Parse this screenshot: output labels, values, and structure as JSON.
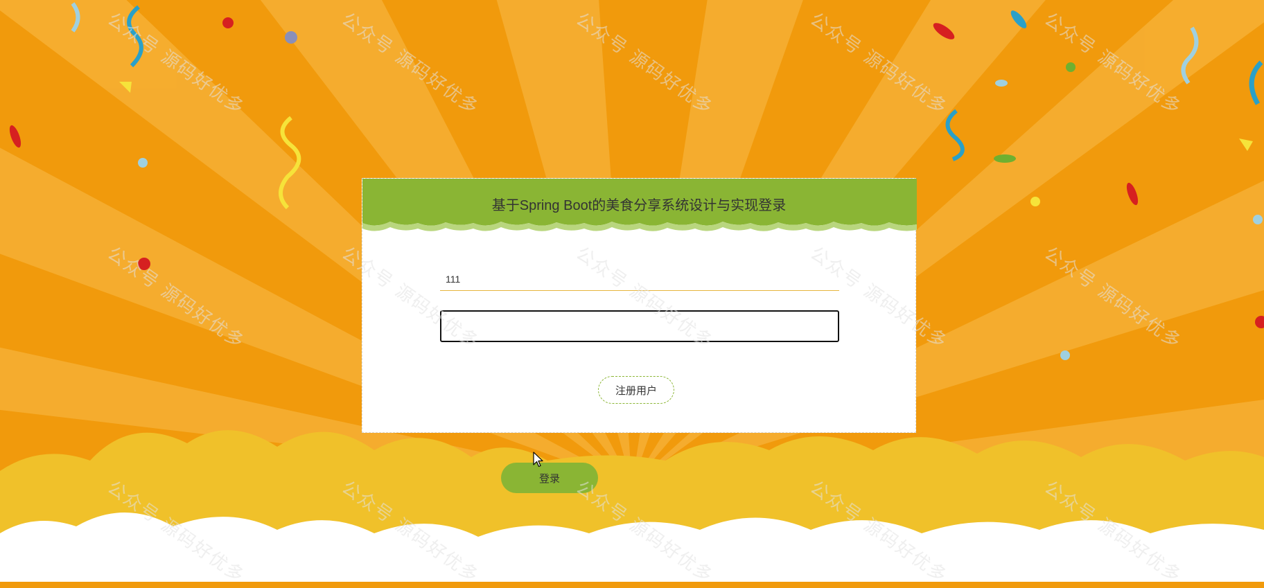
{
  "page": {
    "title": "基于Spring Boot的美食分享系统设计与实现登录"
  },
  "form": {
    "username_value": "111",
    "password_value": "",
    "register_label": "注册用户",
    "login_label": "登录"
  },
  "watermark": {
    "text": "公众号 源码好优多"
  },
  "colors": {
    "background_orange": "#f19a0c",
    "ray_light": "#f7b33a",
    "header_green": "#8ab534",
    "cloud_yellow": "#f0c12a",
    "cloud_white": "#ffffff",
    "field_underline": "#e6b43c"
  },
  "icons": {
    "cursor": "mouse-pointer-icon"
  }
}
